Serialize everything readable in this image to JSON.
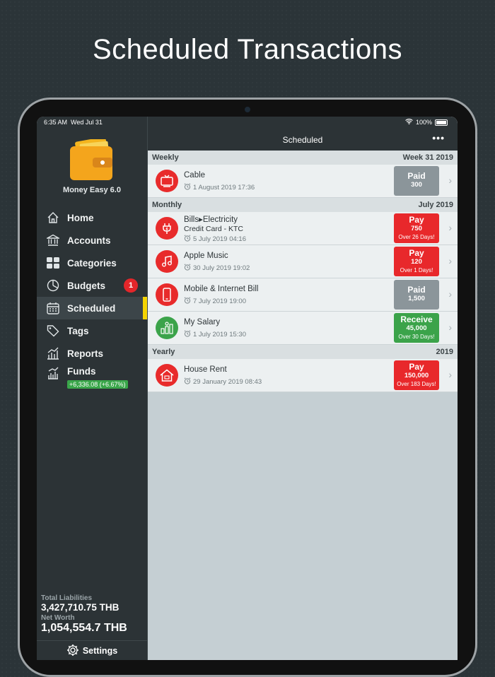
{
  "headline": "Scheduled Transactions",
  "status": {
    "time": "6:35 AM",
    "date": "Wed Jul 31",
    "battery": "100%"
  },
  "sidebar": {
    "app_name": "Money Easy 6.0",
    "items": [
      {
        "label": "Home",
        "icon": "home-icon"
      },
      {
        "label": "Accounts",
        "icon": "bank-icon"
      },
      {
        "label": "Categories",
        "icon": "grid-icon"
      },
      {
        "label": "Budgets",
        "icon": "pie-icon",
        "badge": "1"
      },
      {
        "label": "Scheduled",
        "icon": "calendar-icon",
        "active": true
      },
      {
        "label": "Tags",
        "icon": "tag-icon"
      },
      {
        "label": "Reports",
        "icon": "chart-icon"
      },
      {
        "label": "Funds",
        "icon": "funds-icon",
        "delta": "+6,336.08 (+6.67%)"
      }
    ],
    "total_liabilities_label": "Total Liabilities",
    "total_liabilities_value": "3,427,710.75 THB",
    "net_worth_label": "Net Worth",
    "net_worth_value": "1,054,554.7 THB",
    "settings_label": "Settings"
  },
  "main": {
    "title": "Scheduled",
    "more": "•••",
    "sections": [
      {
        "left": "Weekly",
        "right": "Week 31 2019"
      },
      {
        "left": "Monthly",
        "right": "July 2019"
      },
      {
        "left": "Yearly",
        "right": "2019"
      }
    ],
    "rows": [
      {
        "name": "Cable",
        "date": "1 August 2019 17:36",
        "action": "Paid",
        "amount": "300",
        "note": "",
        "color": "#8b959a",
        "icon": "tv-icon"
      },
      {
        "name": "Bills▸Electricity",
        "sub": "Credit Card - KTC",
        "date": "5 July 2019 04:16",
        "action": "Pay",
        "amount": "750",
        "note": "Over 26 Days!",
        "color": "#e8282b",
        "icon": "plug-icon"
      },
      {
        "name": "Apple Music",
        "date": "30 July 2019 19:02",
        "action": "Pay",
        "amount": "120",
        "note": "Over 1 Days!",
        "color": "#e8282b",
        "icon": "music-note-icon"
      },
      {
        "name": "Mobile & Internet Bill",
        "date": "7 July 2019 19:00",
        "action": "Paid",
        "amount": "1,500",
        "note": "",
        "color": "#8b959a",
        "icon": "phone-icon"
      },
      {
        "name": "My Salary",
        "date": "1 July 2019 15:30",
        "action": "Receive",
        "amount": "45,000",
        "note": "Over 30 Days!",
        "color": "#3ba34a",
        "icon": "money-stack-icon"
      },
      {
        "name": "House Rent",
        "date": "29 January 2019 08:43",
        "action": "Pay",
        "amount": "150,000",
        "note": "Over 183 Days!",
        "color": "#e8282b",
        "icon": "house-icon"
      }
    ]
  }
}
